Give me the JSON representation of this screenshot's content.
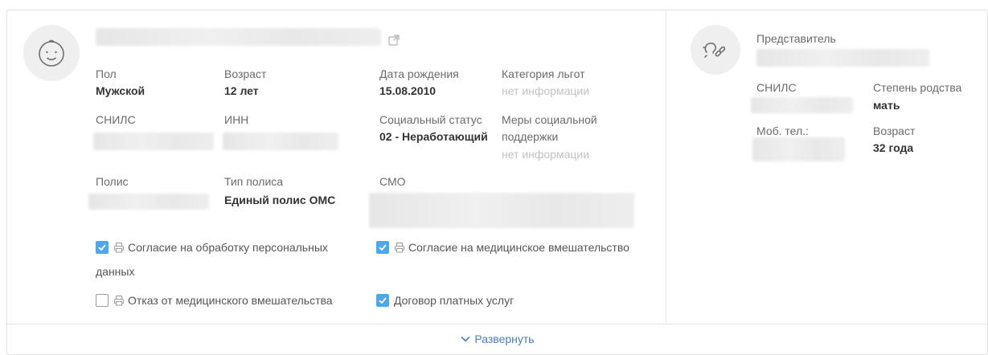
{
  "patient": {
    "gender": {
      "label": "Пол",
      "value": "Мужской"
    },
    "age": {
      "label": "Возраст",
      "value": "12 лет"
    },
    "birth_date": {
      "label": "Дата рождения",
      "value": "15.08.2010"
    },
    "benefit_category": {
      "label": "Категория льгот",
      "value": "нет информации"
    },
    "snils": {
      "label": "СНИЛС"
    },
    "inn": {
      "label": "ИНН"
    },
    "social_status": {
      "label": "Социальный статус",
      "value": "02 - Неработающий"
    },
    "social_support": {
      "label_line1": "Меры социальной",
      "label_line2": "поддержки",
      "value": "нет информации"
    },
    "policy": {
      "label": "Полис"
    },
    "policy_type": {
      "label": "Тип полиса",
      "value": "Единый полис ОМС"
    },
    "smo": {
      "label": "СМО"
    }
  },
  "consents": [
    {
      "line1": "Согласие на обработку персональных",
      "line2": "данных",
      "checked": true,
      "printer": true
    },
    {
      "line1": "Согласие на медицинское вмешательство",
      "checked": true,
      "printer": true
    },
    {
      "line1": "Отказ от медицинского вмешательства",
      "checked": false,
      "printer": true
    },
    {
      "line1": "Договор платных услуг",
      "checked": true,
      "printer": false
    }
  ],
  "representative": {
    "title": "Представитель",
    "snils_label": "СНИЛС",
    "relation": {
      "label": "Степень родства",
      "value": "мать"
    },
    "phone_label": "Моб. тел.:",
    "age": {
      "label": "Возраст",
      "value": "32 года"
    }
  },
  "footer": {
    "expand_label": "Развернуть"
  },
  "colors": {
    "accent": "#4fa7e8",
    "link": "#4a7fc1",
    "muted": "#c2c2c2"
  }
}
